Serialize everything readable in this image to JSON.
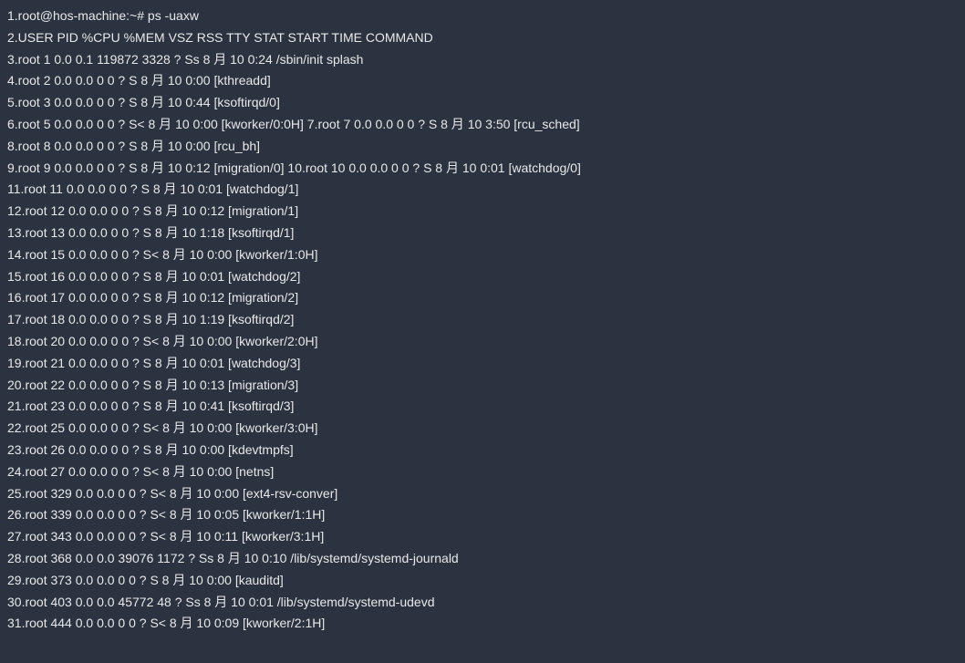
{
  "terminal": {
    "lines": [
      "1.root@hos-machine:~# ps -uaxw",
      "2.USER PID %CPU %MEM VSZ RSS TTY STAT START TIME COMMAND",
      "3.root 1 0.0 0.1 119872 3328 ? Ss 8 月 10 0:24 /sbin/init splash",
      "4.root 2 0.0 0.0 0 0 ? S 8 月 10 0:00 [kthreadd]",
      "5.root 3 0.0 0.0 0 0 ? S 8 月 10 0:44 [ksoftirqd/0]",
      "6.root 5 0.0 0.0 0 0 ? S< 8 月 10 0:00 [kworker/0:0H] 7.root 7 0.0 0.0 0 0 ? S 8 月 10 3:50 [rcu_sched]",
      "8.root 8 0.0 0.0 0 0 ? S 8 月 10 0:00 [rcu_bh]",
      "9.root 9 0.0 0.0 0 0 ? S 8 月 10 0:12 [migration/0] 10.root 10 0.0 0.0 0 0 ? S 8 月 10 0:01 [watchdog/0]",
      "11.root 11 0.0 0.0 0 0 ? S 8 月 10 0:01 [watchdog/1]",
      "12.root 12 0.0 0.0 0 0 ? S 8 月 10 0:12 [migration/1]",
      "13.root 13 0.0 0.0 0 0 ? S 8 月 10 1:18 [ksoftirqd/1]",
      "14.root 15 0.0 0.0 0 0 ? S< 8 月 10 0:00 [kworker/1:0H]",
      "15.root 16 0.0 0.0 0 0 ? S 8 月 10 0:01 [watchdog/2]",
      "16.root 17 0.0 0.0 0 0 ? S 8 月 10 0:12 [migration/2]",
      "17.root 18 0.0 0.0 0 0 ? S 8 月 10 1:19 [ksoftirqd/2]",
      "18.root 20 0.0 0.0 0 0 ? S< 8 月 10 0:00 [kworker/2:0H]",
      "19.root 21 0.0 0.0 0 0 ? S 8 月 10 0:01 [watchdog/3]",
      "20.root 22 0.0 0.0 0 0 ? S 8 月 10 0:13 [migration/3]",
      "21.root 23 0.0 0.0 0 0 ? S 8 月 10 0:41 [ksoftirqd/3]",
      "22.root 25 0.0 0.0 0 0 ? S< 8 月 10 0:00 [kworker/3:0H]",
      "23.root 26 0.0 0.0 0 0 ? S 8 月 10 0:00 [kdevtmpfs]",
      "24.root 27 0.0 0.0 0 0 ? S< 8 月 10 0:00 [netns]",
      "25.root 329 0.0 0.0 0 0 ? S< 8 月 10 0:00 [ext4-rsv-conver]",
      "26.root 339 0.0 0.0 0 0 ? S< 8 月 10 0:05 [kworker/1:1H]",
      "27.root 343 0.0 0.0 0 0 ? S< 8 月 10 0:11 [kworker/3:1H]",
      "28.root 368 0.0 0.0 39076 1172 ? Ss 8 月 10 0:10 /lib/systemd/systemd-journald",
      "29.root 373 0.0 0.0 0 0 ? S 8 月 10 0:00 [kauditd]",
      "30.root 403 0.0 0.0 45772 48 ? Ss 8 月 10 0:01 /lib/systemd/systemd-udevd",
      "31.root 444 0.0 0.0 0 0 ? S< 8 月 10 0:09 [kworker/2:1H]"
    ]
  }
}
